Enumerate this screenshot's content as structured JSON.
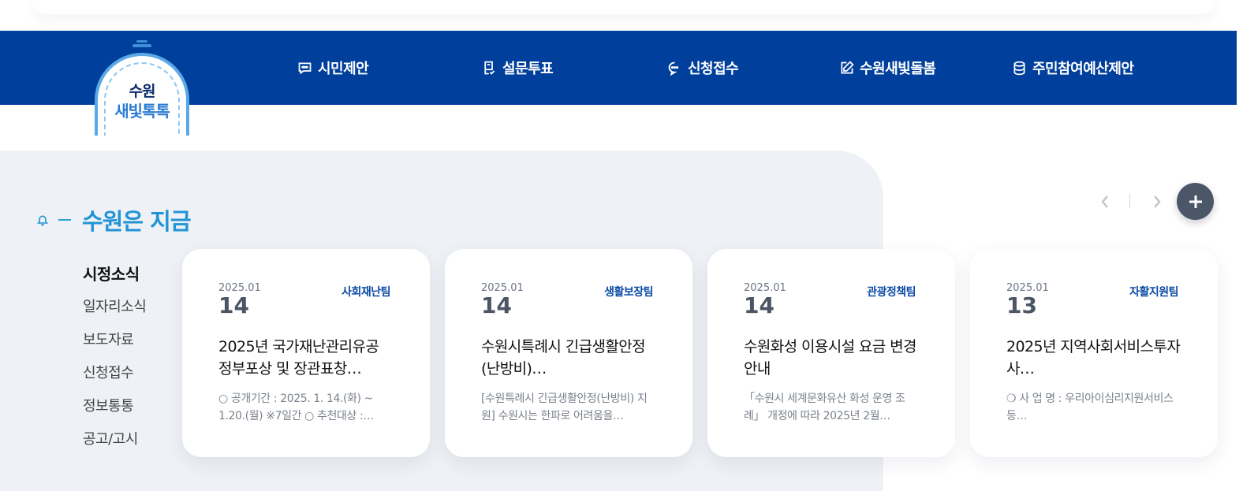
{
  "logo": {
    "line1": "수원",
    "line2": "새빛톡톡"
  },
  "nav": {
    "items": [
      {
        "label": "시민제안",
        "icon": "chat-square-icon"
      },
      {
        "label": "설문투표",
        "icon": "survey-check-icon"
      },
      {
        "label": "신청접수",
        "icon": "chat-bubble-icon"
      },
      {
        "label": "수원새빛돌봄",
        "icon": "pencil-edit-icon"
      },
      {
        "label": "주민참여예산제안",
        "icon": "database-icon"
      }
    ]
  },
  "section": {
    "title": "수원은 지금"
  },
  "categories": [
    "시정소식",
    "일자리소식",
    "보도자료",
    "신청접수",
    "정보통통",
    "공고/고시"
  ],
  "cards": [
    {
      "ym": "2025.01",
      "day": "14",
      "dept": "사회재난팀",
      "title": "2025년 국가재난관리유공 정부포상 및 장관표창…",
      "desc": "○ 공개기간 : 2025. 1. 14.(화) ~ 1.20.(월) ※7일간 ○ 추천대상 :…"
    },
    {
      "ym": "2025.01",
      "day": "14",
      "dept": "생활보장팀",
      "title": "수원시특례시 긴급생활안정(난방비)…",
      "desc": "[수원특례시 긴급생활안정(난방비) 지원] 수원시는 한파로 어려움을…"
    },
    {
      "ym": "2025.01",
      "day": "14",
      "dept": "관광정책팀",
      "title": "수원화성 이용시설 요금 변경 안내",
      "desc": "「수원시 세계문화유산 화성 운영 조례」 개정에 따라 2025년 2월…"
    },
    {
      "ym": "2025.01",
      "day": "13",
      "dept": "자활지원팀",
      "title": "2025년 지역사회서비스투자사…",
      "desc": "❍ 사 업 명 : 우리아이심리지원서비스 등…"
    }
  ],
  "colors": {
    "navbar": "#003f9b",
    "accent": "#2194d6",
    "panel": "#eef1f5"
  }
}
